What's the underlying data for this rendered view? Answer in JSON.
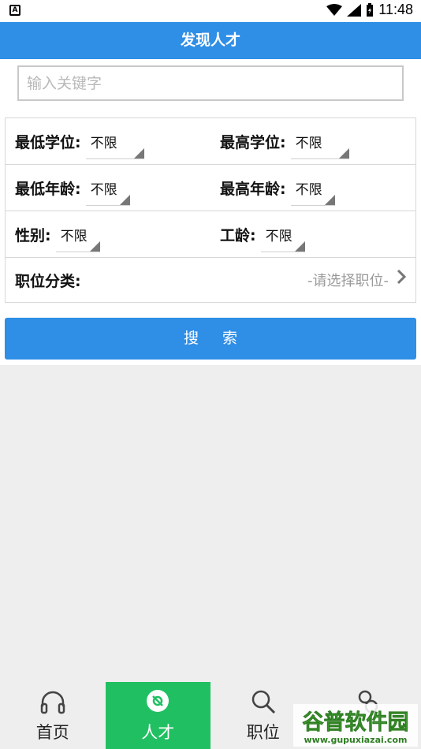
{
  "status_bar": {
    "time": "11:48",
    "notification_icon_letter": "A"
  },
  "app_bar": {
    "title": "发现人才"
  },
  "search": {
    "placeholder": "输入关键字",
    "value": ""
  },
  "filters": {
    "min_degree": {
      "label": "最低学位:",
      "value": "不限"
    },
    "max_degree": {
      "label": "最高学位:",
      "value": "不限"
    },
    "min_age": {
      "label": "最低年龄:",
      "value": "不限"
    },
    "max_age": {
      "label": "最高年龄:",
      "value": "不限"
    },
    "gender": {
      "label": "性别:",
      "value": "不限"
    },
    "work_years": {
      "label": "工龄:",
      "value": "不限"
    },
    "job_category": {
      "label": "职位分类:",
      "placeholder": "-请选择职位-"
    }
  },
  "search_button": {
    "label": "搜 索"
  },
  "bottom_nav": {
    "items": [
      {
        "label": "首页",
        "icon": "headphones-icon"
      },
      {
        "label": "人才",
        "icon": "talent-icon",
        "active": true
      },
      {
        "label": "职位",
        "icon": "search-icon"
      },
      {
        "label": "",
        "icon": "link-icon"
      }
    ]
  },
  "watermark": {
    "text": "谷普软件园",
    "url_text": "www.gupuxiazai.com"
  },
  "colors": {
    "primary": "#2f8ee6",
    "nav_active": "#20c062",
    "background": "#eeeeee"
  }
}
